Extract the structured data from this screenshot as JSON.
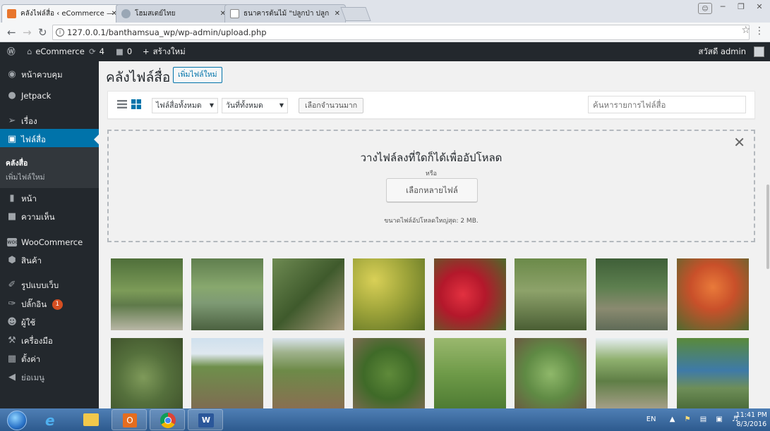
{
  "browser": {
    "tabs": [
      {
        "title": "คลังไฟล์สื่อ ‹ eCommerce — "
      },
      {
        "title": "โฮมสเตย์ไทย"
      },
      {
        "title": "ธนาคารต้นไม้ \"ปลูกป่า ปลูก"
      }
    ],
    "url": "127.0.0.1/banthamsua_wp/wp-admin/upload.php"
  },
  "adminbar": {
    "site": "eCommerce",
    "updates": "4",
    "comments": "0",
    "new": "สร้างใหม่",
    "greeting": "สวัสดี admin"
  },
  "sidebar": {
    "items": [
      {
        "label": "หน้าควบคุม",
        "icon": "dashboard-icon"
      },
      {
        "label": "Jetpack",
        "icon": "jetpack-icon"
      },
      {
        "label": "เรื่อง",
        "icon": "pin-icon"
      },
      {
        "label": "ไฟล์สื่อ",
        "icon": "media-icon"
      },
      {
        "label": "หน้า",
        "icon": "page-icon"
      },
      {
        "label": "ความเห็น",
        "icon": "comment-icon"
      },
      {
        "label": "WooCommerce",
        "icon": "woocommerce-icon"
      },
      {
        "label": "สินค้า",
        "icon": "product-icon"
      },
      {
        "label": "รูปแบบเว็บ",
        "icon": "appearance-icon"
      },
      {
        "label": "ปลั๊กอิน",
        "icon": "plugin-icon",
        "badge": "1"
      },
      {
        "label": "ผู้ใช้",
        "icon": "users-icon"
      },
      {
        "label": "เครื่องมือ",
        "icon": "tools-icon"
      },
      {
        "label": "ตั้งค่า",
        "icon": "settings-icon"
      },
      {
        "label": "ย่อเมนู",
        "icon": "collapse-icon"
      }
    ],
    "submenu": [
      "คลังสื่อ",
      "เพิ่มไฟล์ใหม่"
    ]
  },
  "main": {
    "title": "คลังไฟล์สื่อ",
    "add_new": "เพิ่มไฟล์ใหม่",
    "filter_type": "ไฟล์สื่อทั้งหมด",
    "filter_date": "วันที่ทั้งหมด",
    "bulk_select": "เลือกจำนวนมาก",
    "search_placeholder": "ค้นหารายการไฟล์สื่อ"
  },
  "uploader": {
    "title": "วางไฟล์ลงที่ใดก็ได้เพื่ออัปโหลด",
    "or": "หรือ",
    "button": "เลือกหลายไฟล์",
    "max_size": "ขนาดไฟล์อัปโหลดใหญ่สุด: 2 MB."
  },
  "taskbar": {
    "lang": "EN",
    "time": "11:41 PM",
    "date": "8/3/2016"
  }
}
